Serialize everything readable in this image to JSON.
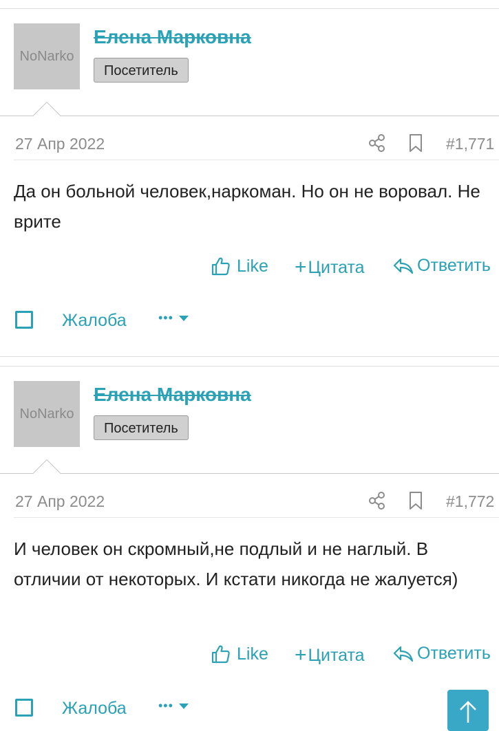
{
  "posts": [
    {
      "avatar_text": "NoNarko",
      "username": "Елена Марковна",
      "badge": "Посетитель",
      "date": "27 Апр 2022",
      "post_number": "#1,771",
      "content": "Да он больной человек,наркоман. Но он не воровал. Не врите",
      "like_label": "Like",
      "quote_label": "Цитата",
      "reply_label": "Ответить",
      "report_label": "Жалоба",
      "more_label": "•••"
    },
    {
      "avatar_text": "NoNarko",
      "username": "Елена Марковна",
      "badge": "Посетитель",
      "date": "27 Апр 2022",
      "post_number": "#1,772",
      "content": "И человек он скромный,не подлый и не наглый. В отличии от некоторых. И кстати никогда не жалуется)",
      "like_label": "Like",
      "quote_label": "Цитата",
      "reply_label": "Ответить",
      "report_label": "Жалоба",
      "more_label": "•••"
    }
  ],
  "colors": {
    "accent": "#2aa1b4",
    "muted": "#8c8c8c",
    "badge_bg": "#d0d0d0",
    "scroll_button": "#39a8c6"
  },
  "icons": {
    "share": "share-icon",
    "bookmark": "bookmark-icon",
    "like": "thumbs-up-icon",
    "quote": "plus-icon",
    "reply": "reply-arrow-icon",
    "more": "caret-down-icon",
    "scroll_top": "arrow-up-icon"
  }
}
